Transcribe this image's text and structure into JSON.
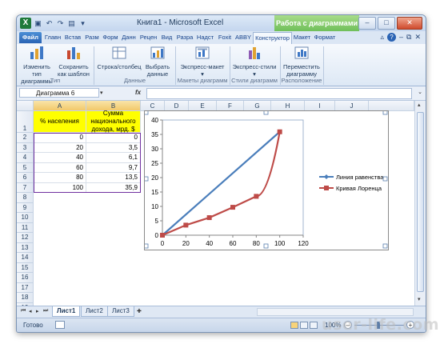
{
  "window": {
    "title": "Книга1 - Microsoft Excel",
    "context_tab": "Работа с диаграммами"
  },
  "tabs": [
    "Файл",
    "Главн",
    "Встав",
    "Разм",
    "Форм",
    "Данн",
    "Рецен",
    "Вид",
    "Разра",
    "Надст",
    "Foxit",
    "ABBY",
    "Конструктор",
    "Макет",
    "Формат"
  ],
  "ribbon": {
    "groups": [
      "Тип",
      "Данные",
      "Макеты диаграмм",
      "Стили диаграмм",
      "Расположение"
    ],
    "btn_change_type": "Изменить тип диаграммы",
    "btn_save_template": "Сохранить как шаблон",
    "btn_row_col": "Строка/столбец",
    "btn_select_data": "Выбрать данные",
    "btn_layouts": "Экспресс-макет",
    "btn_styles": "Экспресс-стили",
    "btn_move": "Переместить диаграмму"
  },
  "formula_bar": {
    "name_box": "Диаграмма 6",
    "fx": "fx",
    "value": ""
  },
  "columns": [
    "A",
    "B",
    "C",
    "D",
    "E",
    "F",
    "G",
    "H",
    "I",
    "J"
  ],
  "rows": [
    "1",
    "2",
    "3",
    "4",
    "5",
    "6",
    "7",
    "8",
    "9",
    "10",
    "11",
    "12",
    "13",
    "14",
    "15",
    "16",
    "17",
    "18",
    "19"
  ],
  "table": {
    "header_a": "% населения",
    "header_b": "Сумма национального дохода, мрд. $",
    "col_a": [
      "0",
      "20",
      "40",
      "60",
      "80",
      "100"
    ],
    "col_b": [
      "0",
      "3,5",
      "6,1",
      "9,7",
      "13,5",
      "35,9"
    ]
  },
  "chart_data": {
    "type": "scatter",
    "x_ticks": [
      "0",
      "20",
      "40",
      "60",
      "80",
      "100",
      "120"
    ],
    "y_ticks": [
      "0",
      "5",
      "10",
      "15",
      "20",
      "25",
      "30",
      "35",
      "40"
    ],
    "xlim": [
      0,
      120
    ],
    "ylim": [
      0,
      40
    ],
    "legend_position": "right",
    "series": [
      {
        "name": "Линия равенства",
        "color": "#4a7ebb",
        "x": [
          0,
          100
        ],
        "y": [
          0,
          35.9
        ]
      },
      {
        "name": "Кривая Лоренца",
        "color": "#be4b48",
        "x": [
          0,
          20,
          40,
          60,
          80,
          100
        ],
        "y": [
          0,
          3.5,
          6.1,
          9.7,
          13.5,
          35.9
        ]
      }
    ]
  },
  "sheets": [
    "Лист1",
    "Лист2",
    "Лист3"
  ],
  "status": {
    "ready": "Готово",
    "zoom": "100%"
  },
  "watermark": "user-life.com"
}
